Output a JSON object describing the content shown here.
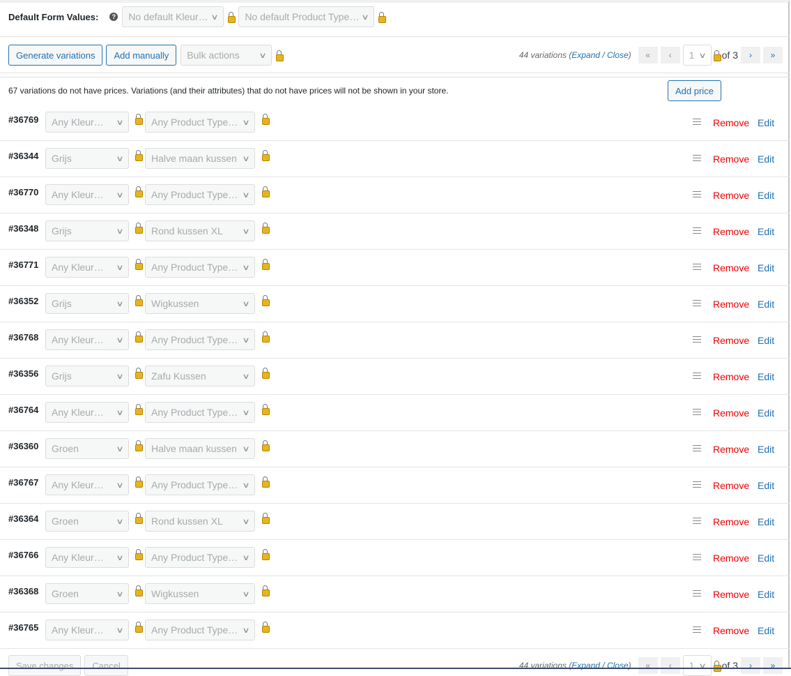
{
  "defaults": {
    "label": "Default Form Values:",
    "kleur": "No default Kleur…",
    "type": "No default Product Type…"
  },
  "toolbar": {
    "generate": "Generate variations",
    "add": "Add manually",
    "bulk": "Bulk actions"
  },
  "pager": {
    "count": "44 variations",
    "expand": "Expand",
    "sep": "/",
    "close": "Close",
    "first": "«",
    "prev": "‹",
    "page": "1",
    "of": "of 3",
    "next": "›",
    "last": "»"
  },
  "notice": {
    "text": "67 variations do not have prices. Variations (and their attributes) that do not have prices will not be shown in your store.",
    "button": "Add price"
  },
  "row_actions": {
    "remove": "Remove",
    "edit": "Edit"
  },
  "variations": [
    {
      "id": "#36769",
      "kleur": "Any Kleur…",
      "type": "Any Product Type…"
    },
    {
      "id": "#36344",
      "kleur": "Grijs",
      "type": "Halve maan kussen"
    },
    {
      "id": "#36770",
      "kleur": "Any Kleur…",
      "type": "Any Product Type…"
    },
    {
      "id": "#36348",
      "kleur": "Grijs",
      "type": "Rond kussen XL"
    },
    {
      "id": "#36771",
      "kleur": "Any Kleur…",
      "type": "Any Product Type…"
    },
    {
      "id": "#36352",
      "kleur": "Grijs",
      "type": "Wigkussen"
    },
    {
      "id": "#36768",
      "kleur": "Any Kleur…",
      "type": "Any Product Type…"
    },
    {
      "id": "#36356",
      "kleur": "Grijs",
      "type": "Zafu Kussen"
    },
    {
      "id": "#36764",
      "kleur": "Any Kleur…",
      "type": "Any Product Type…"
    },
    {
      "id": "#36360",
      "kleur": "Groen",
      "type": "Halve maan kussen"
    },
    {
      "id": "#36767",
      "kleur": "Any Kleur…",
      "type": "Any Product Type…"
    },
    {
      "id": "#36364",
      "kleur": "Groen",
      "type": "Rond kussen XL"
    },
    {
      "id": "#36766",
      "kleur": "Any Kleur…",
      "type": "Any Product Type…"
    },
    {
      "id": "#36368",
      "kleur": "Groen",
      "type": "Wigkussen"
    },
    {
      "id": "#36765",
      "kleur": "Any Kleur…",
      "type": "Any Product Type…"
    }
  ],
  "footer": {
    "save": "Save changes",
    "cancel": "Cancel"
  }
}
